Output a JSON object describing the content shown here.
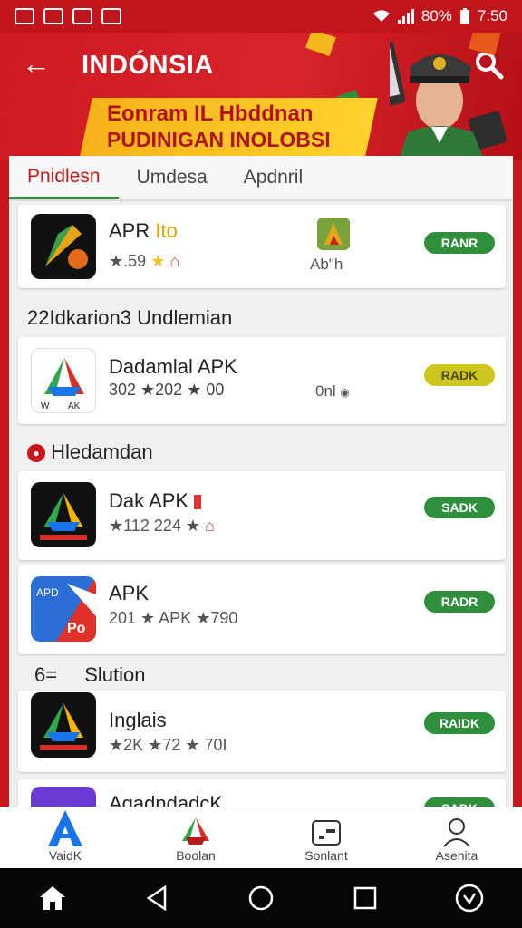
{
  "status_bar": {
    "battery_text": "80%",
    "time": "7:50"
  },
  "header": {
    "title": "INDÓNSIA",
    "banner_line1": "Eonram IL Hbddnan",
    "banner_line2": "PUDINIGAN INOLOBSI"
  },
  "tabs": [
    {
      "label": "Pnidlesn"
    },
    {
      "label": "Umdesa"
    },
    {
      "label": "Apdnril"
    }
  ],
  "cards": [
    {
      "name": "APR",
      "name_tag": "Ito",
      "meta": "★.59",
      "side_label": "Ab\"h",
      "button": "RANR"
    },
    {
      "name": "Dadamlal APK",
      "meta": "302 ★202 ★ 00",
      "side_label": "0nl",
      "button": "RADK"
    },
    {
      "name": "Dak APK",
      "meta": "★112 224 ★",
      "button": "SADK"
    },
    {
      "name": "APK",
      "meta": "201 ★ APK ★790",
      "button": "RADR"
    },
    {
      "name": "Inglais",
      "meta": "★2K ★72 ★ 70I",
      "button": "RAIDK"
    },
    {
      "name": "AgadndadcK",
      "button": "SADK"
    }
  ],
  "sections": [
    {
      "title": "22Idkarion3 Undlemian"
    },
    {
      "title": "Hledamdan"
    },
    {
      "title": "Slution",
      "prefix": "6="
    }
  ],
  "bottom_nav": [
    {
      "label": "VaidK"
    },
    {
      "label": "Boolan"
    },
    {
      "label": "Sonlant"
    },
    {
      "label": "Asenita"
    }
  ],
  "colors": {
    "primary_red": "#c8161d",
    "green": "#2f8f3c",
    "yellow": "#cfc51f"
  }
}
